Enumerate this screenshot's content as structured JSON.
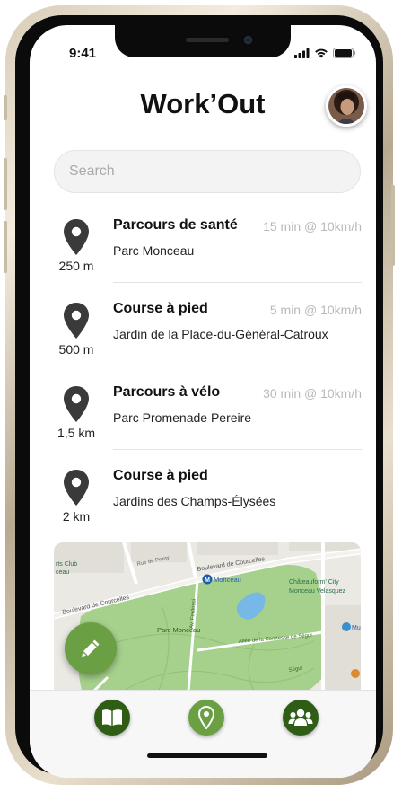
{
  "status_bar": {
    "time": "9:41"
  },
  "header": {
    "title": "Work’Out"
  },
  "search": {
    "placeholder": "Search"
  },
  "routes": [
    {
      "title": "Parcours de santé",
      "meta": "15 min @ 10km/h",
      "place": "Parc Monceau",
      "distance": "250 m"
    },
    {
      "title": "Course à pied",
      "meta": "5 min @ 10km/h",
      "place": "Jardin de la Place-du-Général-Catroux",
      "distance": "500 m"
    },
    {
      "title": "Parcours à vélo",
      "meta": "30 min @ 10km/h",
      "place": "Parc Promenade Pereire",
      "distance": "1,5 km"
    },
    {
      "title": "Course à pied",
      "meta": "",
      "place": "Jardins des Champs-Élysées",
      "distance": "2 km"
    }
  ],
  "map": {
    "labels": {
      "boulevard_top": "Boulevard de Courcelles",
      "boulevard_left": "Boulevard de Courcelles",
      "metro": "Monceau",
      "park": "Parc Monceau",
      "allee": "Allée de la Comtesse de Ségur",
      "chateauform": "Châteauform' City",
      "chateauform2": "Monceau Velasquez",
      "sports_club": "rts Club",
      "sports_club2": "ceau",
      "rue_prony": "Rue de Prony",
      "ave_ferdousi": "Av. Ferdousi",
      "segur": "Ségur",
      "mu": "Mu"
    }
  },
  "tabbar": {
    "icons": [
      "book-icon",
      "location-pin-icon",
      "users-icon"
    ]
  },
  "colors": {
    "accent_green": "#6aa043",
    "dark_green": "#2f5d16",
    "pin": "#3a3a3a",
    "meta_gray": "#b9b9b9"
  }
}
